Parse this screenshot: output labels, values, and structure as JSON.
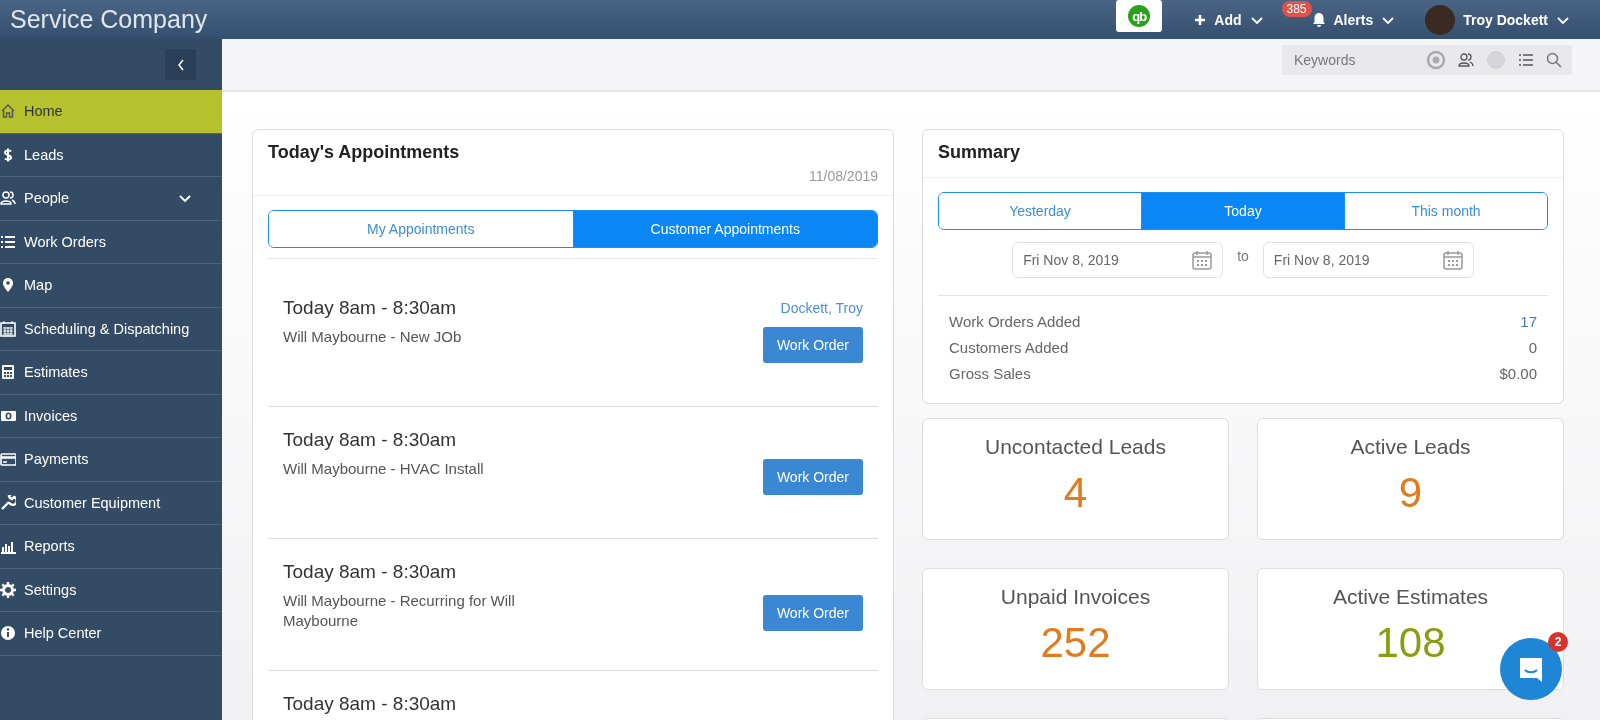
{
  "app": {
    "title": "Service Company"
  },
  "topbar": {
    "logo_text": "qb",
    "add": "Add",
    "alerts": {
      "label": "Alerts",
      "count": "385"
    },
    "user": "Troy Dockett"
  },
  "sidebar": {
    "items": [
      {
        "label": "Home",
        "selected": true,
        "submenu": false
      },
      {
        "label": "Leads",
        "selected": false,
        "submenu": false
      },
      {
        "label": "People",
        "selected": false,
        "submenu": true
      },
      {
        "label": "Work Orders",
        "selected": false,
        "submenu": false
      },
      {
        "label": "Map",
        "selected": false,
        "submenu": false
      },
      {
        "label": "Scheduling & Dispatching",
        "selected": false,
        "submenu": false
      },
      {
        "label": "Estimates",
        "selected": false,
        "submenu": false
      },
      {
        "label": "Invoices",
        "selected": false,
        "submenu": false
      },
      {
        "label": "Payments",
        "selected": false,
        "submenu": false
      },
      {
        "label": "Customer Equipment",
        "selected": false,
        "submenu": false
      },
      {
        "label": "Reports",
        "selected": false,
        "submenu": false
      },
      {
        "label": "Settings",
        "selected": false,
        "submenu": false
      },
      {
        "label": "Help Center",
        "selected": false,
        "submenu": false
      }
    ]
  },
  "search": {
    "placeholder": "Keywords"
  },
  "appointments": {
    "title": "Today's Appointments",
    "date": "11/08/2019",
    "tabs": [
      {
        "label": "My Appointments",
        "selected": false
      },
      {
        "label": "Customer Appointments",
        "selected": true
      }
    ],
    "items": [
      {
        "time": "Today 8am - 8:30am",
        "description": "Will Maybourne - New JOb",
        "assignee": "Dockett, Troy",
        "button": "Work Order"
      },
      {
        "time": "Today 8am - 8:30am",
        "description": "Will Maybourne - HVAC Install",
        "button": "Work Order"
      },
      {
        "time": "Today 8am - 8:30am",
        "description": "Will Maybourne - Recurring for Will Maybourne",
        "button": "Work Order"
      },
      {
        "time": "Today 8am - 8:30am"
      }
    ]
  },
  "summary": {
    "title": "Summary",
    "tabs": [
      {
        "label": "Yesterday",
        "selected": false
      },
      {
        "label": "Today",
        "selected": true
      },
      {
        "label": "This month",
        "selected": false
      }
    ],
    "from": "Fri Nov 8, 2019",
    "separator": "to",
    "to": "Fri Nov 8, 2019",
    "rows": [
      {
        "label": "Work Orders Added",
        "value": "17",
        "kind": "link"
      },
      {
        "label": "Customers Added",
        "value": "0",
        "kind": "plain"
      },
      {
        "label": "Gross Sales",
        "value": "$0.00",
        "kind": "plain"
      }
    ]
  },
  "stats": [
    {
      "label": "Uncontacted Leads",
      "value": "4",
      "color": "#e07b1f"
    },
    {
      "label": "Active Leads",
      "value": "9",
      "color": "#e07b1f"
    },
    {
      "label": "Unpaid Invoices",
      "value": "252",
      "color": "#e07b1f"
    },
    {
      "label": "Active Estimates",
      "value": "108",
      "color": "#8a9c12"
    }
  ],
  "chat": {
    "badge": "2"
  }
}
